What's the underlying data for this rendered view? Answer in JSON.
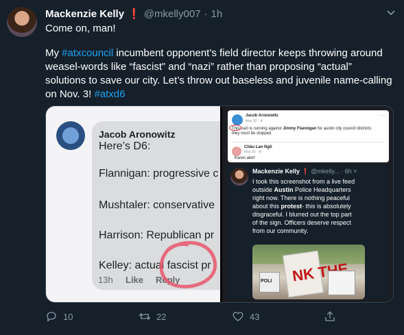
{
  "tweet": {
    "display_name": "Mackenzie Kelly",
    "flag": "❗",
    "handle": "@mkelly007",
    "separator": "·",
    "time": "1h",
    "line1": "Come on, man!",
    "para_part1": "My ",
    "hashtag1": "#atxcouncil",
    "para_part2": " incumbent opponent’s field director keeps throwing around",
    "para_line3": "weasel-words like “fascist” and “nazi” rather than proposing “actual”",
    "para_line4": "solutions to save our city. Let’s throw out baseless and juvenile name-calling",
    "para_line5_part1": "on Nov. 3! ",
    "hashtag2": "#atxd6"
  },
  "media_left": {
    "author": "Jacob Aronowitz",
    "lines": [
      "Here’s D6:",
      "",
      "Flannigan: progressive c",
      "",
      "Mushtaler: conservative",
      "",
      "Harrison: Republican pr",
      "",
      "Kelley: actual fascist pr"
    ],
    "time": "13h",
    "like": "Like",
    "reply": "Reply"
  },
  "media_right": {
    "fb_author": "Jacob Aronowitz",
    "fb_date": "May 30 · ⚙",
    "fb_text_part1": "This nazi is running against ",
    "fb_text_bold": "Jimmy Flannigan",
    "fb_text_part2": " for austin city council districts; they must be stopped",
    "fb_comment_name": "Châu Lan Ngô",
    "fb_comment_date": "May 30 · ⚙",
    "fb_comment_text": "Karen alert",
    "inner_name": "Mackenzie Kelly",
    "inner_flag": "❗",
    "inner_meta": "@mkelly... · 6h ˅",
    "inner_line1": "I took this screenshot from a live feed",
    "inner_line2_pre": "outside ",
    "inner_line2_bold": "Austin",
    "inner_line2_post": " Police Headquarters",
    "inner_line3": "right now. There is nothing peaceful",
    "inner_line4_pre": "about this ",
    "inner_line4_bold": "protest",
    "inner_line4_post": "- this is absolutely",
    "inner_line5": "disgraceful. I blurred out the top part",
    "inner_line6": "of the sign. Officers deserve respect",
    "inner_line7": "from our community.",
    "photo_sign_text": "NK THE",
    "photo_sign_small": "POLI"
  },
  "actions": {
    "reply_count": "10",
    "retweet_count": "22",
    "like_count": "43"
  },
  "colors": {
    "background": "#15202b",
    "accent": "#1da1f2",
    "muted": "#8899a6",
    "flag": "#e0245e"
  }
}
